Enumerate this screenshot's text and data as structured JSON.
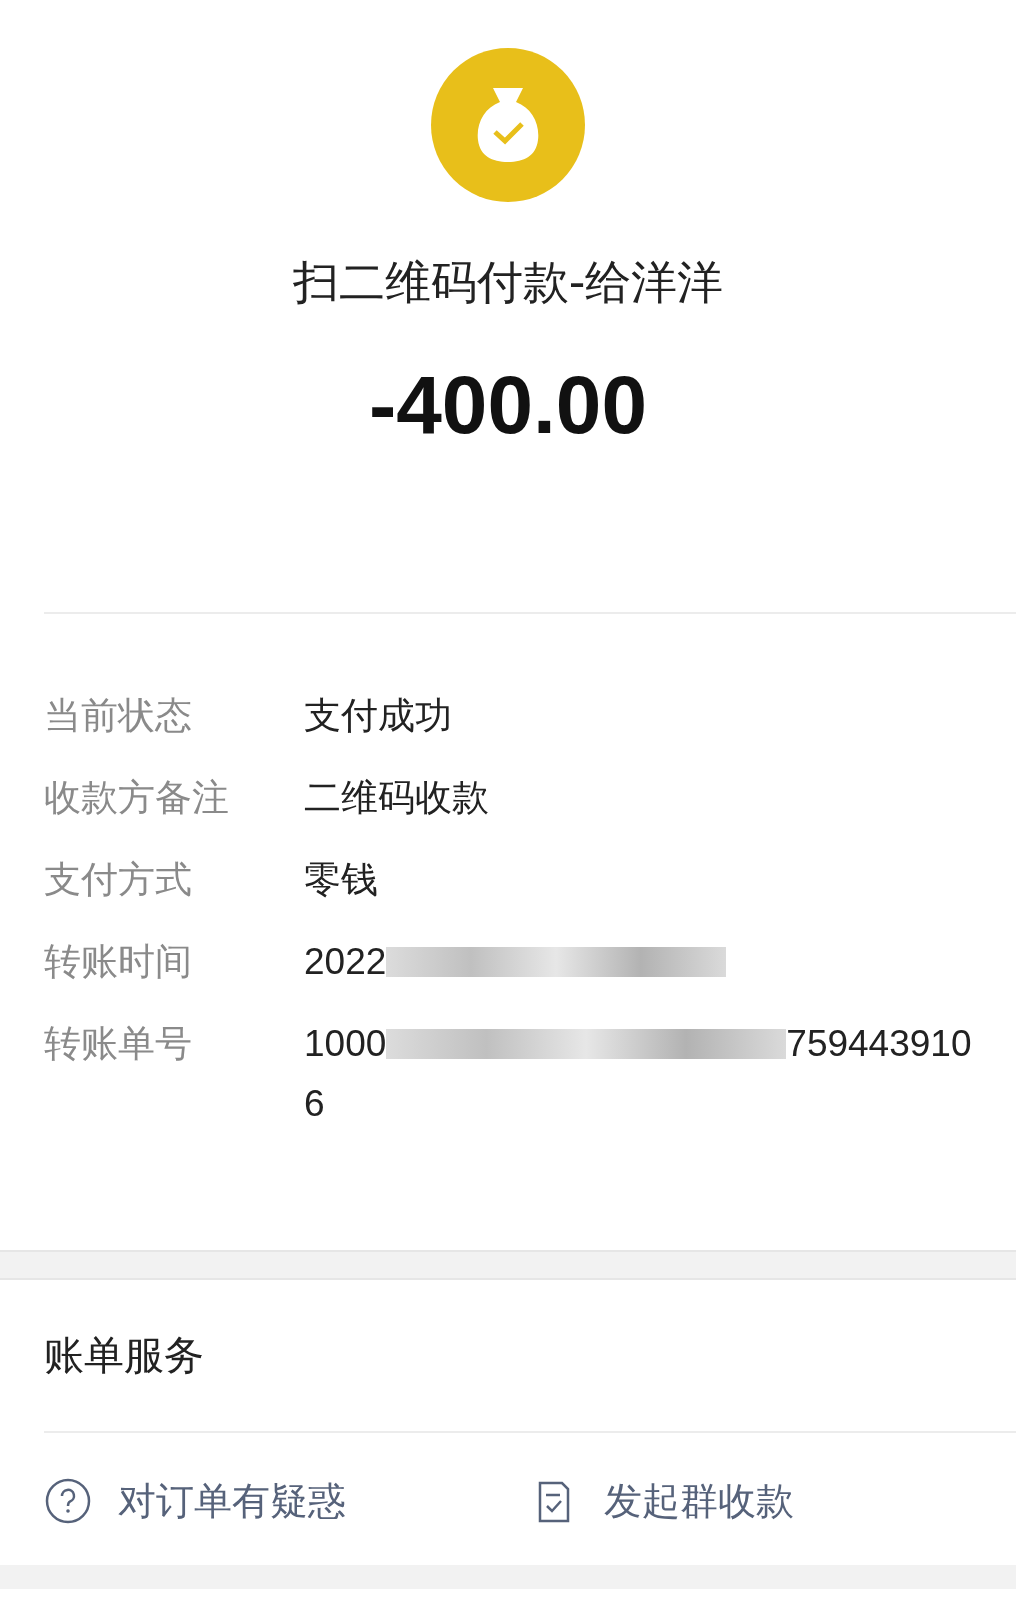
{
  "header": {
    "title": "扫二维码付款-给洋洋",
    "amount": "-400.00"
  },
  "details": [
    {
      "label": "当前状态",
      "value": "支付成功",
      "redacted": false
    },
    {
      "label": "收款方备注",
      "value": "二维码收款",
      "redacted": false
    },
    {
      "label": "支付方式",
      "value": "零钱",
      "redacted": false
    },
    {
      "label": "转账时间",
      "value": "2022",
      "redacted": true
    },
    {
      "label": "转账单号",
      "value": "1000",
      "value_end": "759443910",
      "continuation": "6",
      "redacted": true
    }
  ],
  "services": {
    "title": "账单服务",
    "actions": [
      {
        "kind": "question",
        "label": "对订单有疑惑"
      },
      {
        "kind": "document",
        "label": "发起群收款"
      }
    ]
  }
}
